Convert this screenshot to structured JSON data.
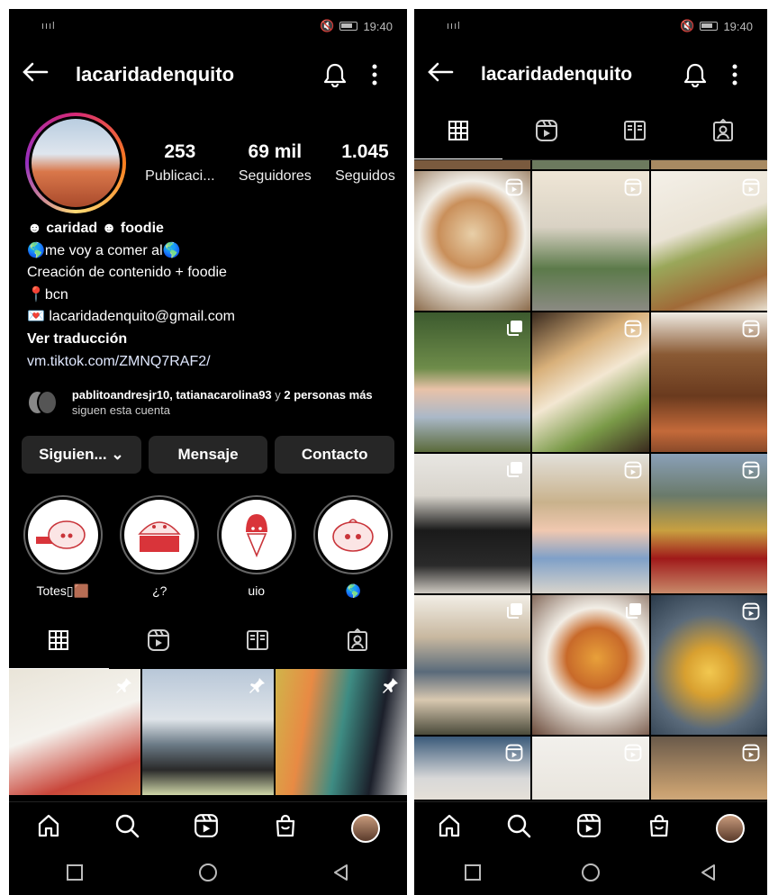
{
  "status": {
    "time": "19:40",
    "signal": "ıııl"
  },
  "profile": {
    "username": "lacaridadenquito",
    "stats": [
      {
        "num": "253",
        "label": "Publicaci..."
      },
      {
        "num": "69 mil",
        "label": "Seguidores"
      },
      {
        "num": "1.045",
        "label": "Seguidos"
      }
    ],
    "bio": {
      "name": "☻ caridad ☻ foodie",
      "line1": "🌎me voy a comer al🌎",
      "line2": "Creación de contenido + foodie",
      "line3": "📍bcn",
      "email": "💌 lacaridadenquito@gmail.com",
      "translate": "Ver traducción",
      "link": "vm.tiktok.com/ZMNQ7RAF2/"
    },
    "followed_by": {
      "names": "pablitoandresjr10, tatianacarolina93",
      "middle": " y ",
      "rest": "2 personas más",
      "suffix": " siguen esta cuenta"
    },
    "buttons": {
      "following": "Siguien... ⌄",
      "message": "Mensaje",
      "contact": "Contacto"
    },
    "highlights": [
      {
        "label": "Totes▯🟫"
      },
      {
        "label": "¿?"
      },
      {
        "label": "uio"
      },
      {
        "label": "🌎"
      }
    ]
  },
  "icons": {
    "back": "arrow-left-icon",
    "bell": "bell-icon",
    "more": "more-vertical-icon",
    "grid": "grid-icon",
    "reels": "reels-icon",
    "guides": "guides-icon",
    "tagged": "tagged-icon",
    "home": "home-icon",
    "search": "search-icon",
    "shop": "shop-icon"
  },
  "colors": {
    "background": "#000000",
    "button": "#262626",
    "link": "#e0e8ff"
  }
}
